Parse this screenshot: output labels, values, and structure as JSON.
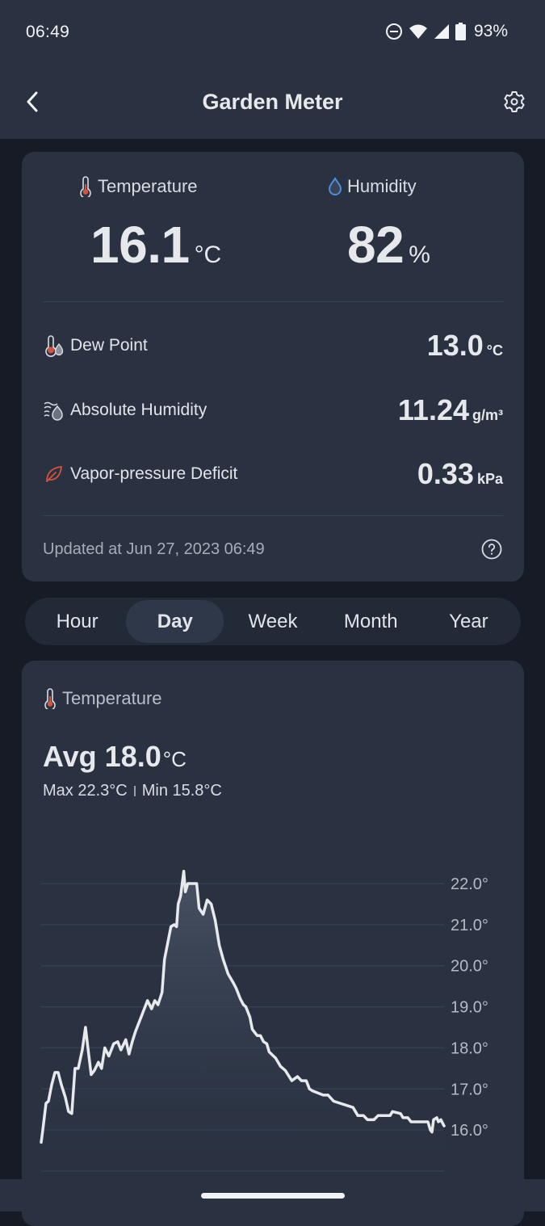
{
  "status_bar": {
    "time": "06:49",
    "icons": [
      "do-not-disturb-icon",
      "wifi-icon",
      "cell-signal-icon",
      "battery-icon"
    ],
    "battery_percent": "93%"
  },
  "app_bar": {
    "title": "Garden Meter",
    "back_icon": "chevron-left-icon",
    "settings_icon": "gear-icon"
  },
  "current": {
    "temperature": {
      "label": "Temperature",
      "value": "16.1",
      "unit": "°C",
      "icon": "thermometer-icon"
    },
    "humidity": {
      "label": "Humidity",
      "value": "82",
      "unit": "%",
      "icon": "water-drop-icon"
    },
    "details": [
      {
        "label": "Dew Point",
        "value": "13.0",
        "unit": "°C",
        "icon": "dew-point-icon"
      },
      {
        "label": "Absolute Humidity",
        "value": "11.24",
        "unit": "g/m³",
        "icon": "absolute-humidity-icon"
      },
      {
        "label": "Vapor-pressure Deficit",
        "value": "0.33",
        "unit": "kPa",
        "icon": "leaf-icon"
      }
    ],
    "updated": "Updated at Jun 27, 2023 06:49",
    "help_icon": "help-circle-icon"
  },
  "range_tabs": {
    "items": [
      "Hour",
      "Day",
      "Week",
      "Month",
      "Year"
    ],
    "selected": "Day"
  },
  "chart_card": {
    "metric_label": "Temperature",
    "avg_label": "Avg 18.0",
    "avg_unit": "°C",
    "max_label": "Max 22.3°C",
    "min_label": "Min 15.8°C"
  },
  "colors": {
    "accent_temperature": "#d6533c",
    "accent_humidity": "#4a8fe0",
    "header_bg": "#2a3242",
    "page_bg": "#161b26",
    "card_bg": "#2a3242",
    "line": "#e8e9ec"
  },
  "chart_data": {
    "type": "area",
    "title": "Temperature",
    "xlabel": "",
    "ylabel": "",
    "ylim": [
      15.0,
      22.0
    ],
    "y_ticks": [
      22.0,
      21.0,
      20.0,
      19.0,
      18.0,
      17.0,
      16.0,
      15.0
    ],
    "y_tick_labels": [
      "22.0°",
      "21.0°",
      "20.0°",
      "19.0°",
      "18.0°",
      "17.0°",
      "16.0°",
      ""
    ],
    "grid": true,
    "y_axis_position": "right",
    "x_range": [
      0,
      100
    ],
    "series": [
      {
        "name": "Temperature",
        "x": [
          0,
          0.4,
          1.2,
          1.8,
          2.6,
          3.4,
          4.2,
          5.0,
          6.0,
          6.8,
          7.6,
          8.4,
          9.2,
          10.2,
          11.0,
          11.6,
          12.4,
          13.2,
          14.2,
          15.0,
          15.8,
          16.8,
          18.0,
          19.0,
          19.8,
          21.0,
          21.8,
          22.6,
          23.4,
          24.4,
          25.4,
          26.4,
          27.4,
          28.2,
          29.0,
          30.0,
          30.6,
          31.4,
          32.2,
          33.0,
          33.6,
          34.0,
          34.6,
          35.4,
          35.8,
          36.4,
          37.0,
          38.6,
          39.2,
          40.2,
          41.2,
          42.2,
          43.2,
          44.2,
          45.2,
          46.4,
          47.6,
          48.4,
          49.4,
          50.2,
          50.8,
          51.8,
          52.4,
          53.6,
          54.4,
          55.2,
          56.0,
          56.6,
          58.2,
          59.4,
          60.6,
          62.2,
          63.6,
          64.6,
          65.8,
          66.6,
          67.4,
          70.0,
          71.2,
          72.6,
          77.4,
          78.6,
          80.0,
          81.0,
          82.6,
          83.6,
          86.6,
          87.2,
          89.2,
          89.8,
          91.0,
          91.8,
          93.0,
          96.0,
          96.6,
          97.0,
          97.4,
          98.2,
          98.6,
          99.2,
          100
        ],
        "values": [
          15.7,
          16.0,
          16.65,
          16.7,
          17.1,
          17.4,
          17.4,
          17.1,
          16.8,
          16.45,
          16.4,
          17.5,
          17.5,
          17.95,
          18.5,
          18.0,
          17.35,
          17.45,
          17.65,
          17.5,
          18.0,
          17.8,
          18.1,
          18.15,
          17.95,
          18.2,
          17.85,
          18.15,
          18.4,
          18.65,
          18.9,
          19.15,
          18.95,
          19.15,
          19.05,
          19.35,
          20.15,
          20.55,
          20.95,
          21.0,
          20.95,
          21.5,
          21.7,
          22.3,
          21.8,
          22.0,
          22.0,
          22.0,
          21.4,
          21.25,
          21.6,
          21.5,
          21.1,
          20.5,
          20.15,
          19.8,
          19.6,
          19.45,
          19.2,
          19.05,
          19.0,
          18.75,
          18.45,
          18.3,
          18.3,
          18.15,
          18.1,
          17.9,
          17.75,
          17.55,
          17.45,
          17.2,
          17.3,
          17.2,
          17.2,
          17.0,
          16.95,
          16.85,
          16.85,
          16.7,
          16.55,
          16.35,
          16.35,
          16.25,
          16.25,
          16.35,
          16.35,
          16.45,
          16.4,
          16.3,
          16.3,
          16.2,
          16.2,
          16.2,
          16.0,
          15.95,
          16.25,
          16.3,
          16.2,
          16.25,
          16.1
        ]
      }
    ]
  }
}
